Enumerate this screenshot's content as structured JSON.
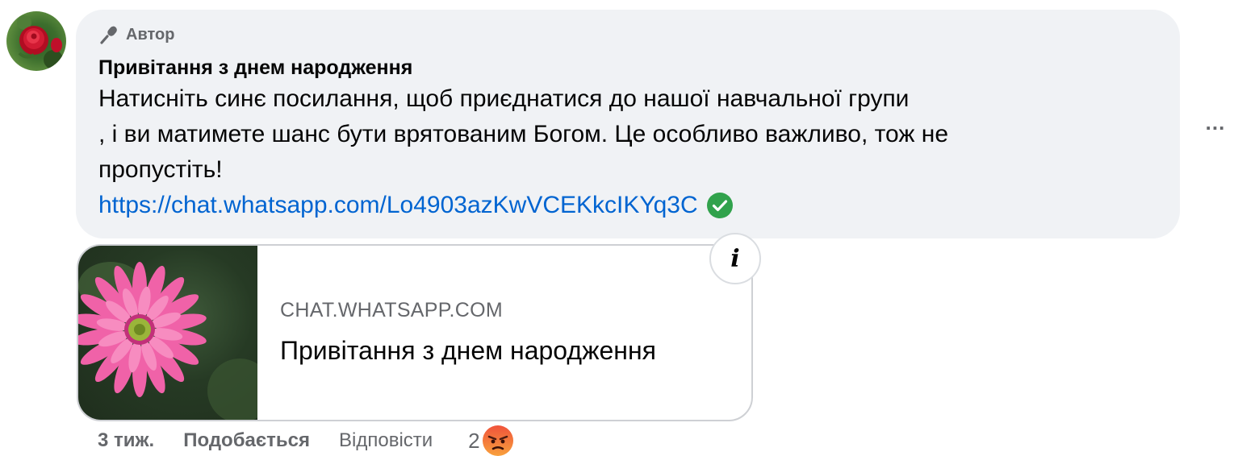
{
  "comment": {
    "author_badge": "Автор",
    "title": "Привітання з днем народження",
    "lines": [
      "Натисніть синє посилання, щоб приєднатися до нашої навчальної групи",
      ", і ви матимете шанс бути врятованим Богом. Це особливо важливо, тож не",
      "пропустіть!"
    ],
    "link": "https://chat.whatsapp.com/Lo4903azKwVCEKkcIKYq3C"
  },
  "more_menu": {
    "label": "..."
  },
  "preview": {
    "domain": "CHAT.WHATSAPP.COM",
    "title": "Привітання з днем народження",
    "info_label": "i"
  },
  "actions": {
    "time": "3 тиж.",
    "like": "Подобається",
    "reply": "Відповісти",
    "reaction_count": "2"
  },
  "icons": {
    "author": "microphone-icon",
    "verified": "check-circle-icon",
    "reaction": "angry-face-icon"
  },
  "colors": {
    "bubble_bg": "#f0f2f5",
    "link": "#0064d1",
    "secondary_text": "#65676b",
    "verified": "#31a24c"
  }
}
